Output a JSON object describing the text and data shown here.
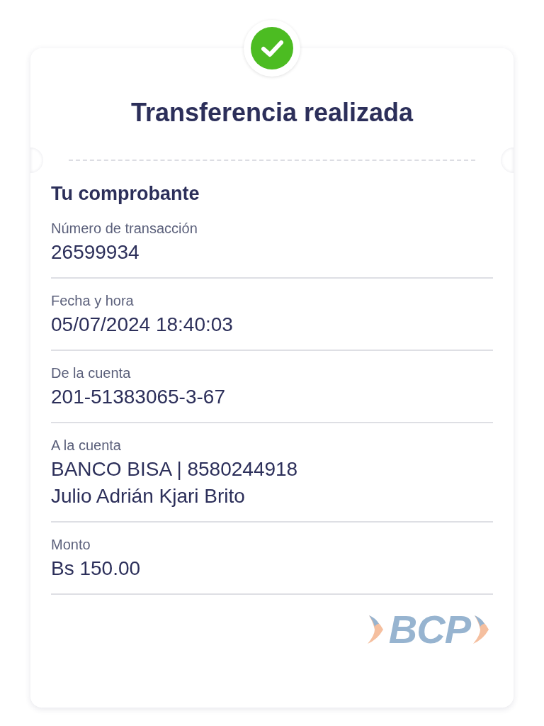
{
  "title": "Transferencia realizada",
  "section_title": "Tu comprobante",
  "fields": [
    {
      "label": "Número de transacción",
      "values": [
        "26599934"
      ]
    },
    {
      "label": "Fecha y hora",
      "values": [
        "05/07/2024 18:40:03"
      ]
    },
    {
      "label": "De la cuenta",
      "values": [
        "201-51383065-3-67"
      ]
    },
    {
      "label": "A la cuenta",
      "values": [
        "BANCO BISA | 8580244918",
        "Julio Adrián Kjari Brito"
      ]
    },
    {
      "label": "Monto",
      "values": [
        "Bs 150.00"
      ]
    }
  ],
  "logo": "BCP"
}
